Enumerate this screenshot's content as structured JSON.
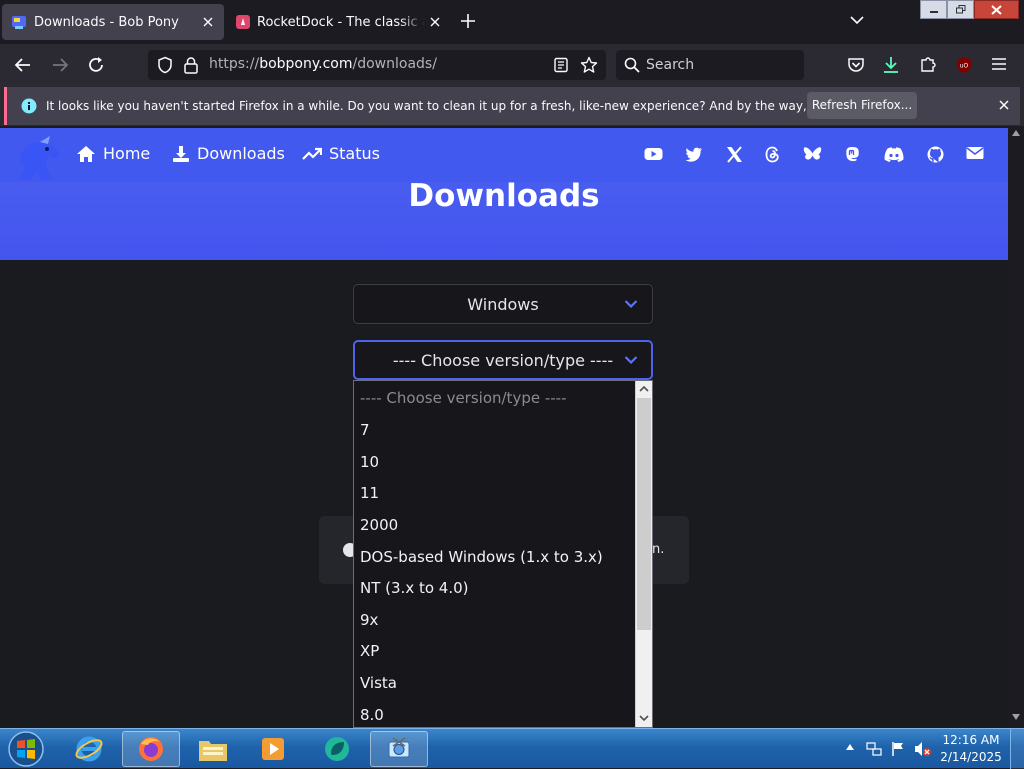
{
  "browser": {
    "tabs": [
      {
        "title": "Downloads - Bob Pony",
        "active": true
      },
      {
        "title": "RocketDock - The classic app la",
        "active": false
      }
    ],
    "url_prefix": "https://",
    "url_host": "bobpony.com",
    "url_path": "/downloads/",
    "search_placeholder": "Search",
    "notification": {
      "text": "It looks like you haven't started Firefox in a while. Do you want to clean it up for a fresh, like-new experience? And by the way, welcome back!",
      "button": "Refresh Firefox..."
    }
  },
  "site": {
    "nav": [
      {
        "label": "Home",
        "icon": "home-icon"
      },
      {
        "label": "Downloads",
        "icon": "download-icon"
      },
      {
        "label": "Status",
        "icon": "trending-up-icon"
      }
    ],
    "social_icons": [
      "youtube-icon",
      "twitter-icon",
      "x-icon",
      "threads-icon",
      "bluesky-icon",
      "mastodon-icon",
      "discord-icon",
      "github-icon",
      "email-icon"
    ],
    "page_title": "Downloads",
    "os_select": {
      "value": "Windows"
    },
    "version_select": {
      "value": "---- Choose version/type ----",
      "options": [
        "---- Choose version/type ----",
        "7",
        "10",
        "11",
        "2000",
        "DOS-based Windows (1.x to 3.x)",
        "NT (3.x to 4.0)",
        "9x",
        "XP",
        "Vista",
        "8.0"
      ]
    },
    "info_text_tail": "n."
  },
  "taskbar": {
    "apps": [
      "start-button",
      "internet-explorer-icon",
      "firefox-icon",
      "file-explorer-icon",
      "media-player-icon",
      "rocketdock-icon",
      "screenshot-tool-icon"
    ],
    "time": "12:16 AM",
    "date": "2/14/2025"
  },
  "colors": {
    "accent": "#4159ef",
    "page_bg": "#1a1b1f",
    "taskbar": "#1f63ab",
    "notification_stripe": "#ff6b92"
  }
}
